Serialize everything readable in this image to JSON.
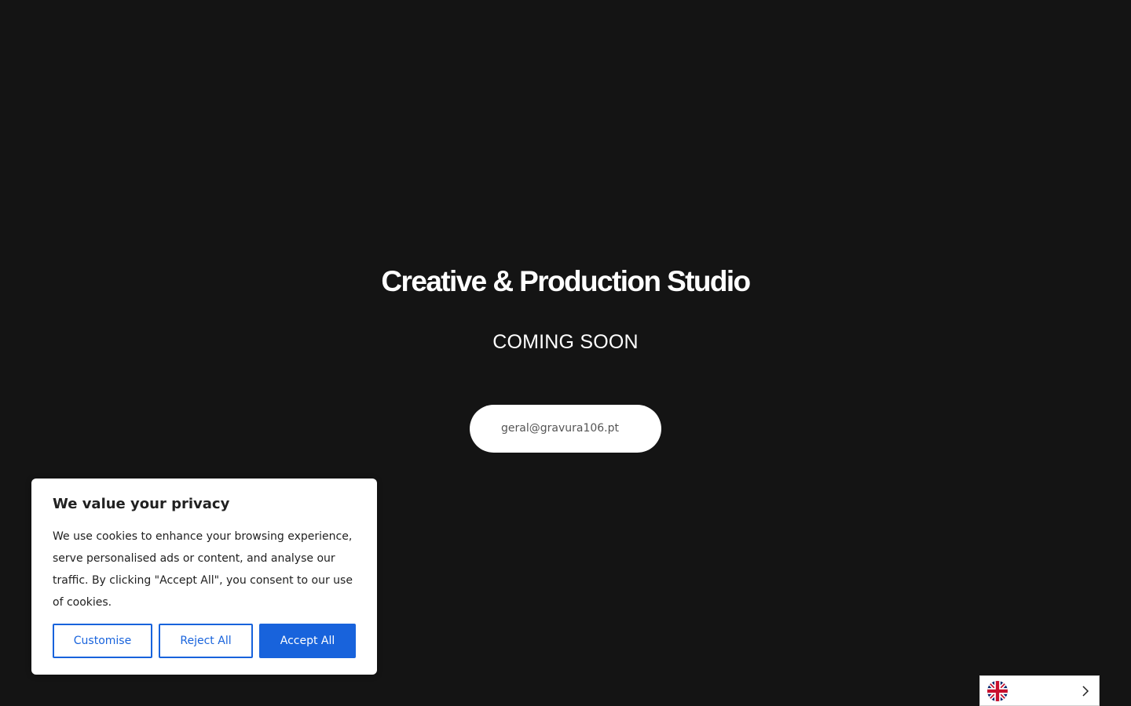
{
  "hero": {
    "title": "Creative & Production Studio",
    "subtitle": "COMING SOON",
    "email": "geral@gravura106.pt"
  },
  "cookie_banner": {
    "title": "We value your privacy",
    "text": "We use cookies to enhance your browsing experience, serve personalised ads or content, and analyse our traffic. By clicking \"Accept All\", you consent to our use of cookies.",
    "customise_label": "Customise",
    "reject_label": "Reject All",
    "accept_label": "Accept All",
    "accent_color": "#1863dc"
  },
  "language_switcher": {
    "flag_icon": "uk-flag-icon",
    "chevron_icon": "chevron-right-icon"
  },
  "colors": {
    "background": "#141414",
    "text": "#ffffff"
  }
}
